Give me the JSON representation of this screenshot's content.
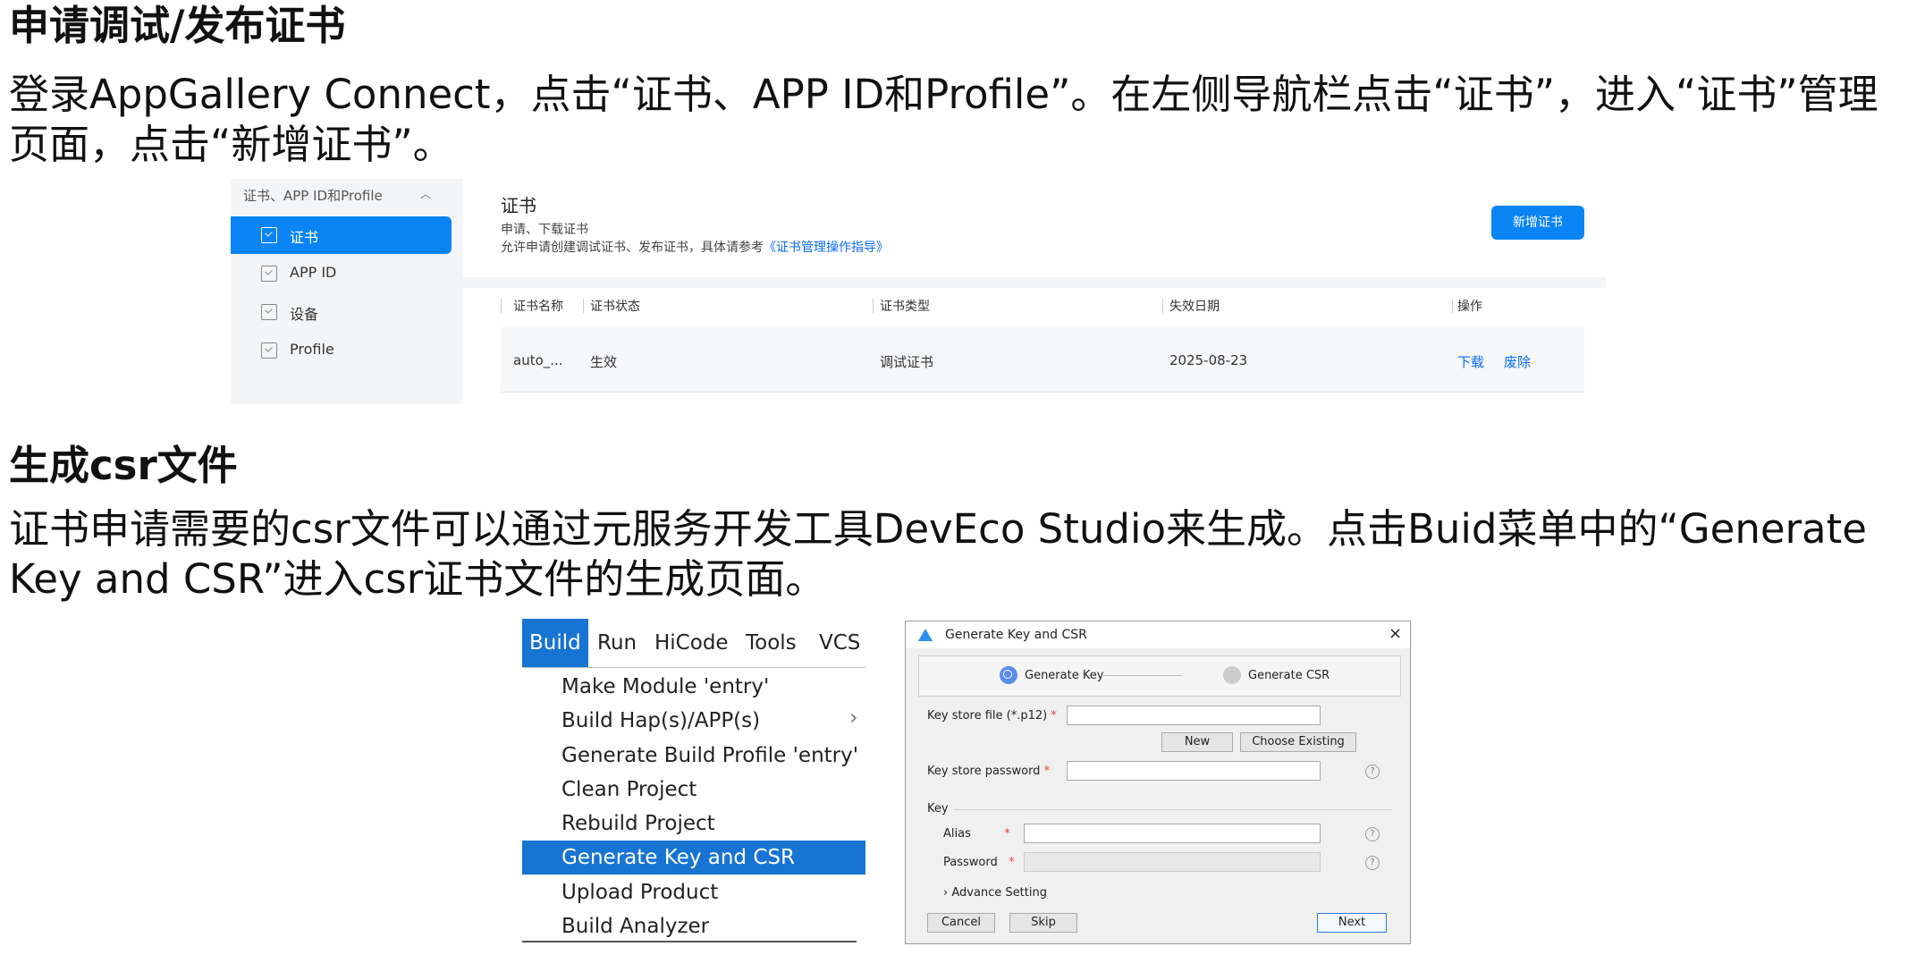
{
  "section1": {
    "heading": "申请调试/发布证书",
    "line1": "登录AppGallery Connect，点击“证书、APP ID和Profile”。在左侧导航栏点击“证书”，进入“证书”管理",
    "line2": "页面，点击“新增证书”。"
  },
  "agc": {
    "sidebar_title": "证书、APP ID和Profile",
    "sidebar_items": [
      {
        "label": "证书",
        "active": true
      },
      {
        "label": "APP ID",
        "active": false
      },
      {
        "label": "设备",
        "active": false
      },
      {
        "label": "Profile",
        "active": false
      }
    ],
    "title": "证书",
    "subtitle1": "申请、下载证书",
    "subtitle2_prefix": "允许申请创建调试证书、发布证书，具体请参考",
    "subtitle2_link": "《证书管理操作指导》",
    "new_button": "新增证书",
    "table": {
      "headers": [
        "证书名称",
        "证书状态",
        "证书类型",
        "失效日期",
        "操作"
      ],
      "rows": [
        {
          "name": "auto_...",
          "status": "生效",
          "type": "调试证书",
          "expiry": "2025-08-23",
          "download": "下载",
          "revoke": "废除"
        }
      ]
    },
    "accent_color": "#0a84f5"
  },
  "section2": {
    "heading": "生成csr文件",
    "line1": "证书申请需要的csr文件可以通过元服务开发工具DevEco Studio来生成。点击Buid菜单中的“Generate",
    "line2": "Key and CSR”进入csr证书文件的生成页面。"
  },
  "build_menu": {
    "menubar": [
      "Build",
      "Run",
      "HiCode",
      "Tools",
      "VCS"
    ],
    "items": [
      "Make Module 'entry'",
      "Build Hap(s)/APP(s)",
      "Generate Build Profile 'entry'",
      "Clean Project",
      "Rebuild Project",
      "Generate Key and CSR",
      "Upload Product",
      "Build Analyzer"
    ],
    "highlighted": "Generate Key and CSR",
    "highlight_color": "#1874d2"
  },
  "dialog": {
    "title": "Generate Key and CSR",
    "step1": "Generate Key",
    "step2": "Generate CSR",
    "keystore_label": "Key store file (*.p12)",
    "new_button": "New",
    "choose_button": "Choose Existing",
    "password_label": "Key store password",
    "key_group": "Key",
    "alias_label": "Alias",
    "key_password_label": "Password",
    "advance": "Advance Setting",
    "cancel": "Cancel",
    "skip": "Skip",
    "next": "Next",
    "required_mark": "*",
    "help_mark": "?",
    "close_mark": "×"
  }
}
